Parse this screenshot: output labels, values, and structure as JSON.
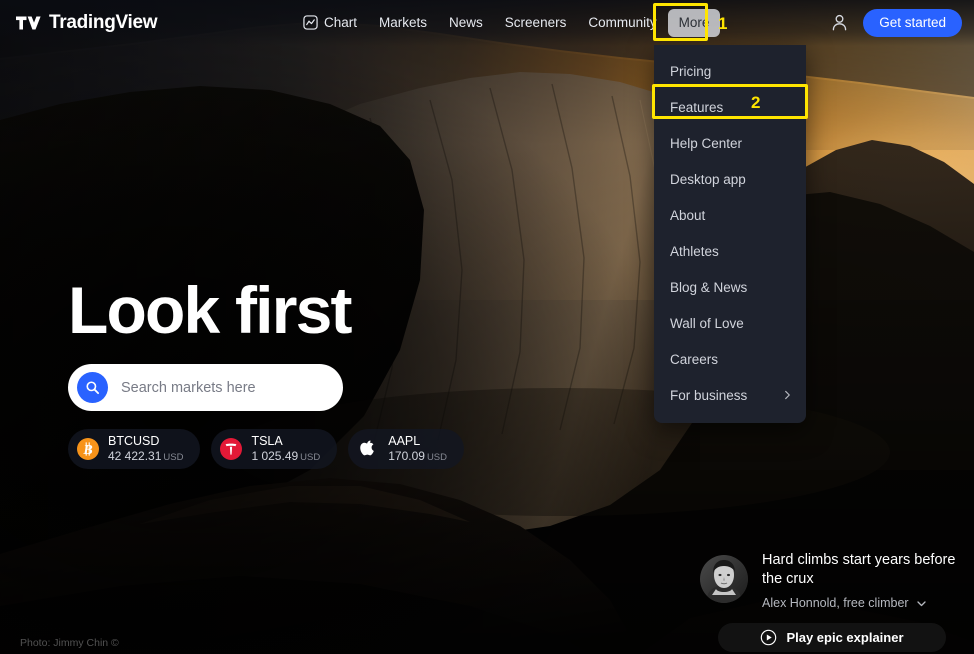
{
  "brand": {
    "name": "TradingView",
    "logo_icon": "tradingview-logo-icon",
    "accent_blue": "#2962ff",
    "menu_bg": "#1e222d",
    "annotation_yellow": "#ffe500"
  },
  "header": {
    "nav": [
      {
        "label": "Chart",
        "icon": "chart-icon",
        "active": false
      },
      {
        "label": "Markets",
        "icon": "",
        "active": false
      },
      {
        "label": "News",
        "icon": "",
        "active": false
      },
      {
        "label": "Screeners",
        "icon": "",
        "active": false
      },
      {
        "label": "Community",
        "icon": "",
        "active": false
      },
      {
        "label": "More",
        "icon": "",
        "active": true
      }
    ],
    "user_icon": "user-account-icon",
    "get_started_label": "Get started"
  },
  "more_menu": {
    "items": [
      {
        "label": "Pricing",
        "has_submenu": false,
        "highlighted": false
      },
      {
        "label": "Features",
        "has_submenu": false,
        "highlighted": true
      },
      {
        "label": "Help Center",
        "has_submenu": false,
        "highlighted": false
      },
      {
        "label": "Desktop app",
        "has_submenu": false,
        "highlighted": false
      },
      {
        "label": "About",
        "has_submenu": false,
        "highlighted": false
      },
      {
        "label": "Athletes",
        "has_submenu": false,
        "highlighted": false
      },
      {
        "label": "Blog & News",
        "has_submenu": false,
        "highlighted": false
      },
      {
        "label": "Wall of Love",
        "has_submenu": false,
        "highlighted": false
      },
      {
        "label": "Careers",
        "has_submenu": false,
        "highlighted": false
      },
      {
        "label": "For business",
        "has_submenu": true,
        "highlighted": false
      }
    ],
    "submenu_icon": "chevron-right-icon"
  },
  "annotations": [
    {
      "number": "1",
      "target": "More nav button"
    },
    {
      "number": "2",
      "target": "Features menu item"
    }
  ],
  "hero": {
    "title": "Look first",
    "search": {
      "placeholder": "Search markets here",
      "value": "",
      "icon": "search-icon"
    }
  },
  "tickers": [
    {
      "symbol": "BTCUSD",
      "price": "42 422.31",
      "currency": "USD",
      "logo": "bitcoin-icon"
    },
    {
      "symbol": "TSLA",
      "price": "1 025.49",
      "currency": "USD",
      "logo": "tesla-icon"
    },
    {
      "symbol": "AAPL",
      "price": "170.09",
      "currency": "USD",
      "logo": "apple-icon"
    }
  ],
  "photo_credit": "Photo: Jimmy Chin ©",
  "testimonial": {
    "avatar_icon": "avatar-portrait",
    "quote": "Hard climbs start years before the crux",
    "attribution": "Alex Honnold, free climber",
    "expand_icon": "chevron-down-icon",
    "play_button_label": "Play epic explainer",
    "play_icon": "play-circle-icon"
  }
}
